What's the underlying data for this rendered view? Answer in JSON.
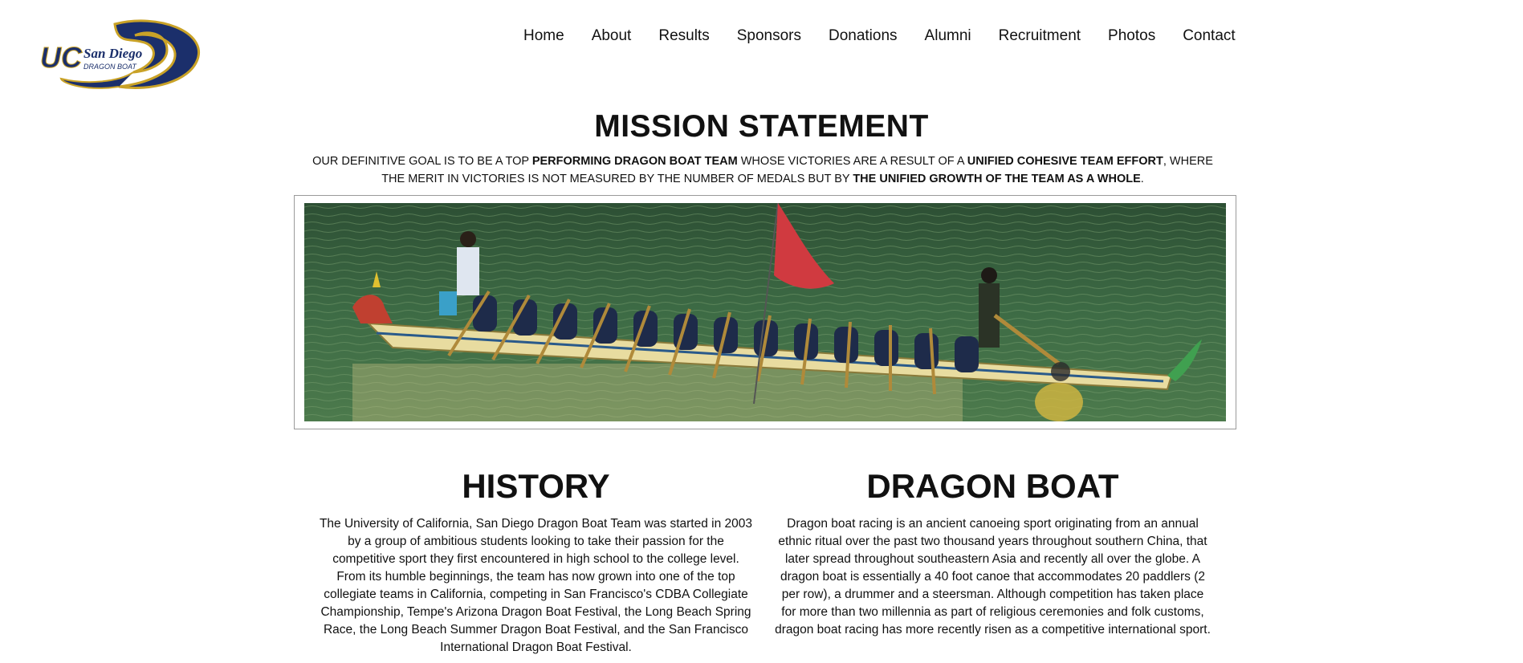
{
  "logo": {
    "primary": "UC",
    "secondary": "San Diego",
    "tagline": "DRAGON BOAT",
    "colors": {
      "navy": "#1b2f6b",
      "gold": "#c9a227"
    }
  },
  "nav": {
    "items": [
      {
        "label": "Home"
      },
      {
        "label": "About"
      },
      {
        "label": "Results"
      },
      {
        "label": "Sponsors"
      },
      {
        "label": "Donations"
      },
      {
        "label": "Alumni"
      },
      {
        "label": "Recruitment"
      },
      {
        "label": "Photos"
      },
      {
        "label": "Contact"
      }
    ]
  },
  "mission": {
    "title": "MISSION STATEMENT",
    "text_1": "OUR DEFINITIVE GOAL IS TO BE A TOP ",
    "text_2": "PERFORMING DRAGON BOAT TEAM",
    "text_3": " WHOSE VICTORIES ARE A RESULT OF A ",
    "text_4": "UNIFIED COHESIVE TEAM EFFORT",
    "text_5": ", WHERE THE MERIT IN VICTORIES IS NOT MEASURED BY THE NUMBER OF MEDALS BUT BY ",
    "text_6": "THE UNIFIED GROWTH OF THE TEAM AS A WHOLE",
    "text_7": "."
  },
  "history": {
    "title": "HISTORY",
    "body": "The University of California, San Diego Dragon Boat Team was started in 2003 by a group of ambitious students looking to take their passion for the competitive sport they first encountered in high school to the college level. From its humble beginnings, the team has now grown into one of the top collegiate teams in California, competing in San Francisco's CDBA Collegiate Championship, Tempe's Arizona Dragon Boat Festival, the Long Beach Spring Race, the Long Beach Summer Dragon Boat Festival, and the San Francisco International Dragon Boat Festival."
  },
  "dragon_boat": {
    "title": "DRAGON BOAT",
    "body": "Dragon boat racing is an ancient canoeing sport originating from an annual ethnic ritual over the past two thousand years throughout southern China, that later spread throughout southeastern Asia and recently all over the globe. A dragon boat is essentially a 40 foot canoe that accommodates 20 paddlers (2 per row), a drummer and a steersman. Although competition has taken place for more than two millennia as part of religious ceremonies and folk customs, dragon boat racing has more recently risen as a competitive international sport."
  }
}
